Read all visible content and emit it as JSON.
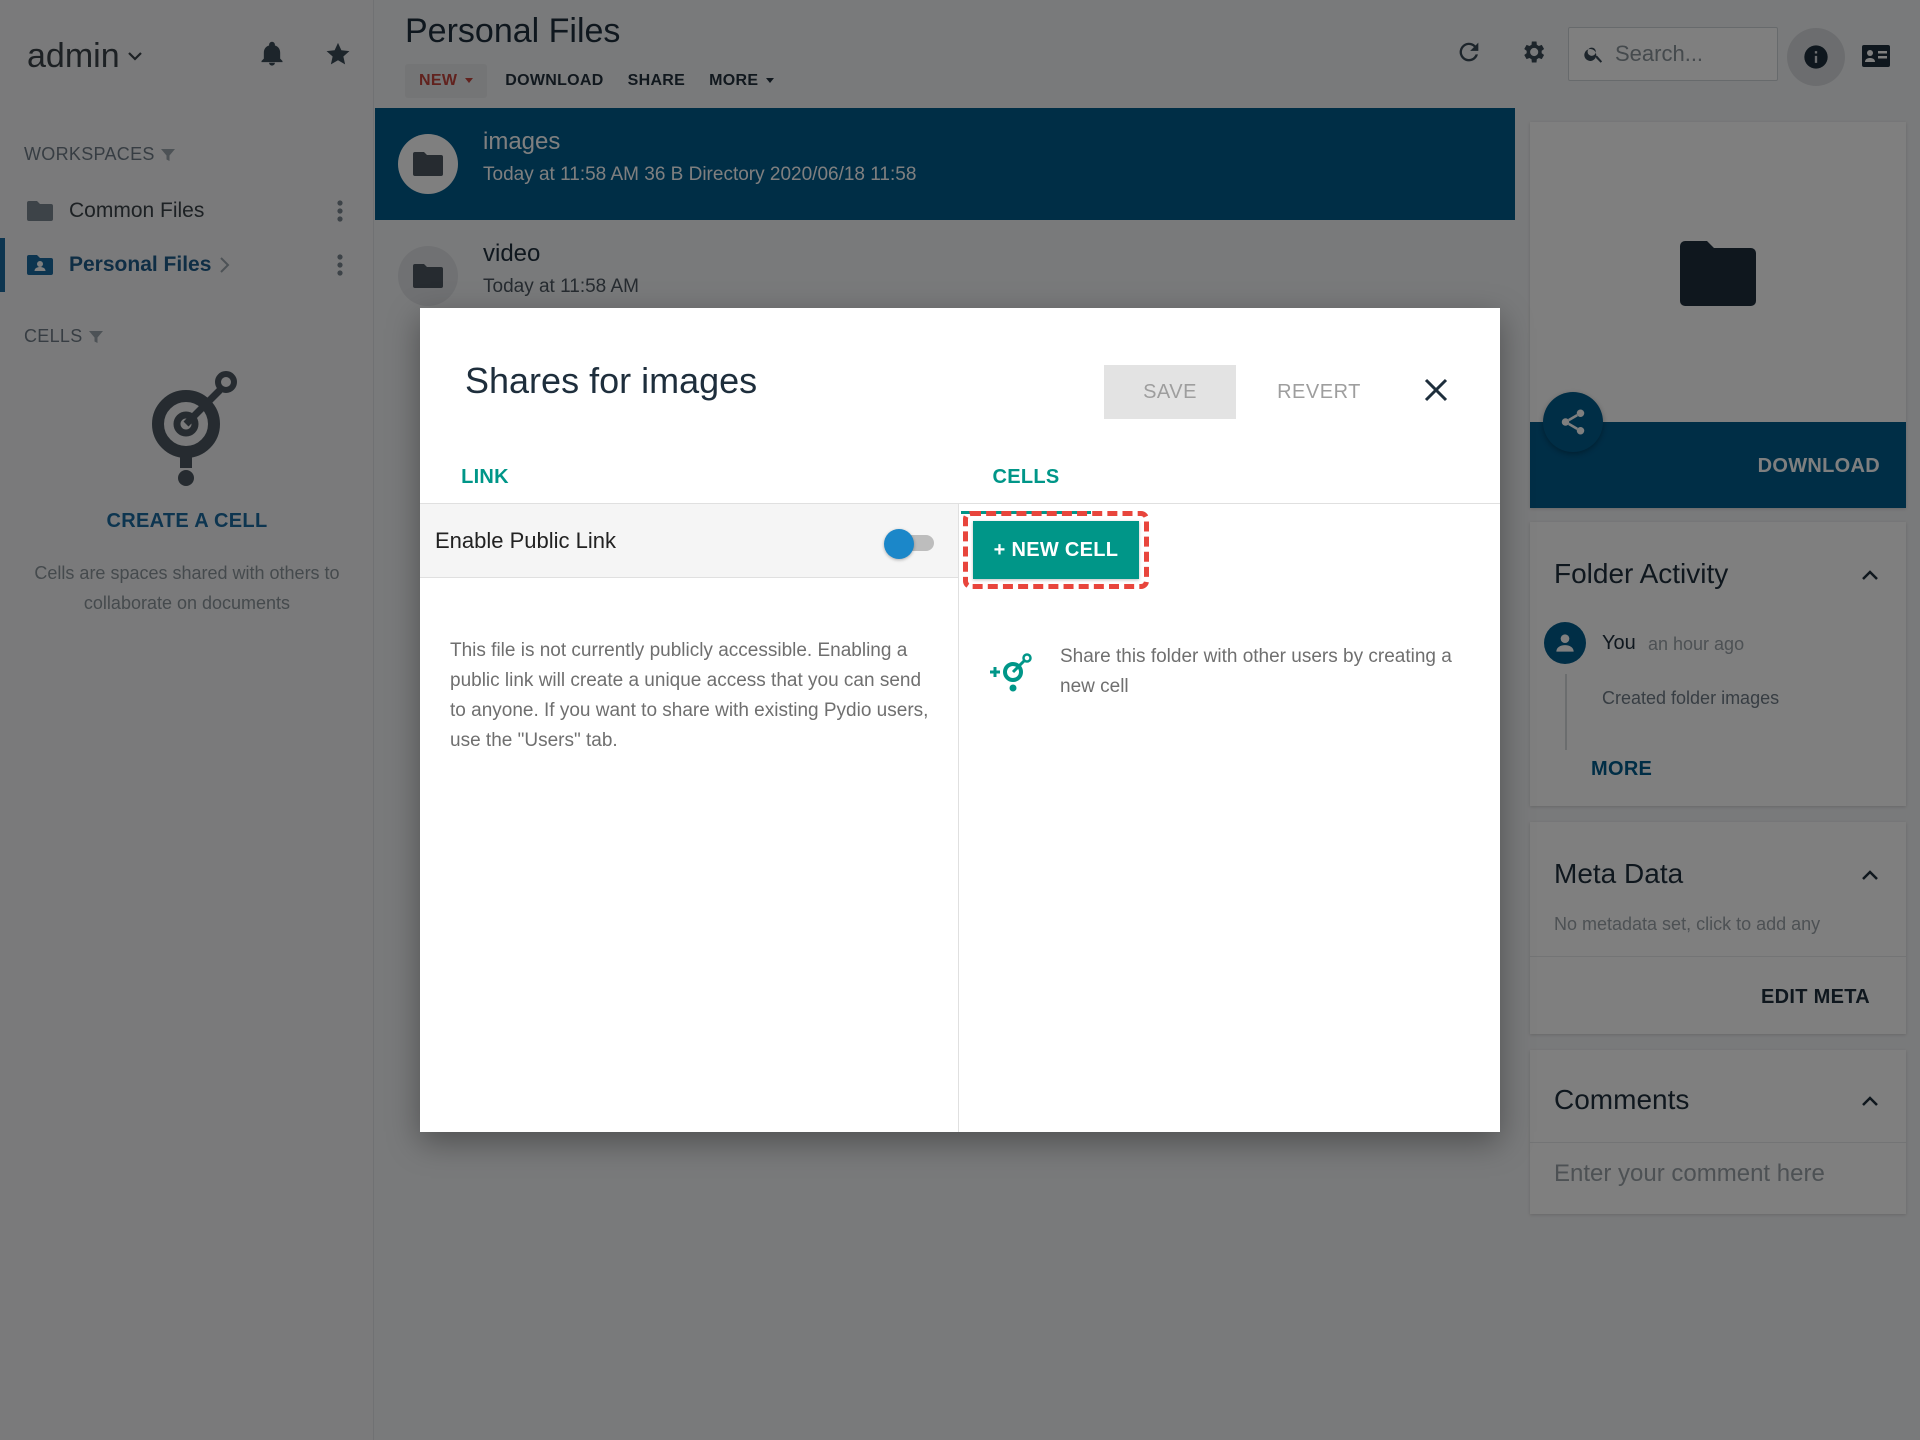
{
  "sidebar": {
    "user_name": "admin",
    "workspaces_label": "WORKSPACES",
    "workspaces": [
      {
        "label": "Common Files"
      },
      {
        "label": "Personal Files"
      }
    ],
    "cells_label": "CELLS",
    "create_cell_label": "CREATE A CELL",
    "cells_description": "Cells are spaces shared with others to collaborate on documents"
  },
  "header": {
    "title": "Personal Files",
    "toolbar": {
      "new_label": "NEW",
      "download_label": "DOWNLOAD",
      "share_label": "SHARE",
      "more_label": "MORE"
    },
    "search_placeholder": "Search..."
  },
  "files": [
    {
      "name": "images",
      "meta": "Today at 11:58 AM   36 B   Directory   2020/06/18 11:58",
      "selected": true
    },
    {
      "name": "video",
      "meta": "Today at 11:58 AM",
      "selected": false
    }
  ],
  "right_panel": {
    "download_label": "DOWNLOAD",
    "folder_activity": {
      "title": "Folder Activity",
      "user": "You",
      "time": "an hour ago",
      "text": "Created folder images",
      "more_label": "MORE"
    },
    "meta_data": {
      "title": "Meta Data",
      "empty_text": "No metadata set, click to add any",
      "edit_label": "EDIT META"
    },
    "comments": {
      "title": "Comments",
      "placeholder": "Enter your comment here"
    }
  },
  "dialog": {
    "title": "Shares for images",
    "save_label": "SAVE",
    "revert_label": "REVERT",
    "tabs": [
      {
        "label": "LINK"
      },
      {
        "label": "CELLS"
      }
    ],
    "link": {
      "enable_label": "Enable Public Link",
      "enabled": false,
      "description": "This file is not currently publicly accessible. Enabling a public link will create a unique access that you can send to anyone. If you want to share with existing Pydio users, use the \"Users\" tab."
    },
    "cells": {
      "new_cell_label": "+ NEW CELL",
      "description": "Share this folder with other users by creating a new cell"
    }
  },
  "colors": {
    "primary_blue": "#005c8d",
    "teal": "#009688",
    "highlight_red": "#e8453c",
    "new_red": "#c3443c"
  }
}
